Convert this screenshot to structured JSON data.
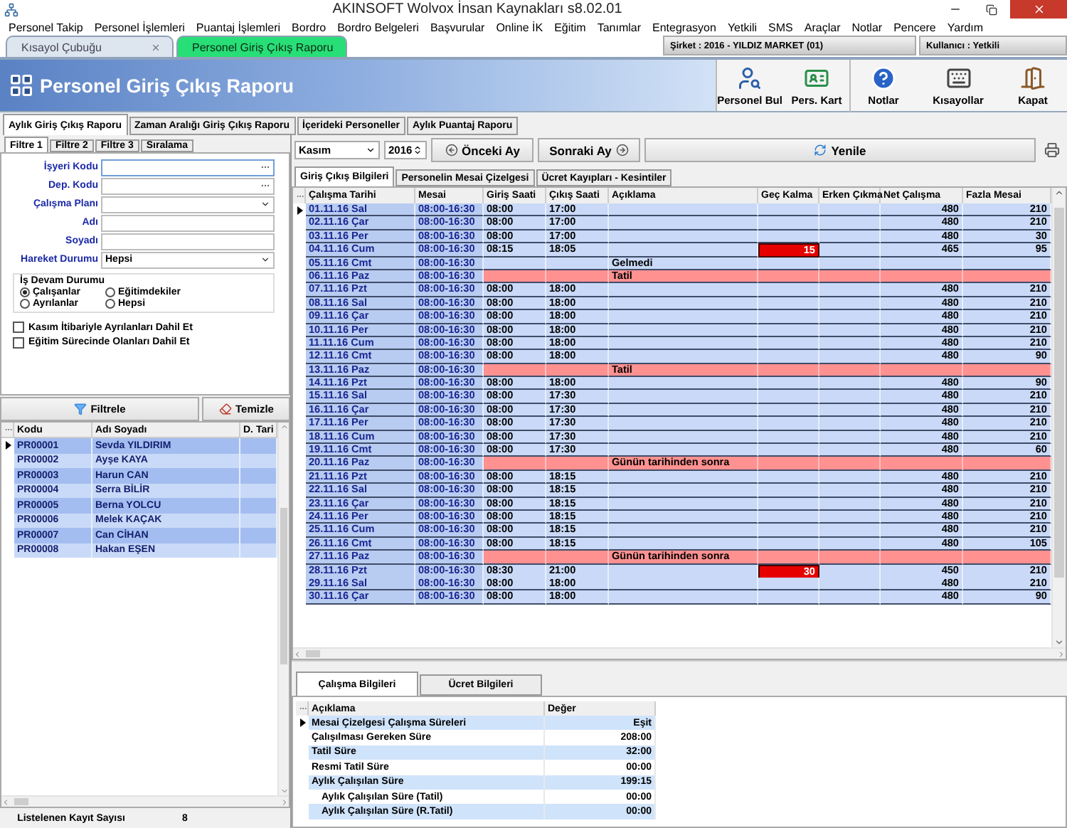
{
  "window": {
    "title": "AKINSOFT Wolvox İnsan Kaynakları s8.02.01"
  },
  "menu": [
    "Personel Takip",
    "Personel İşlemleri",
    "Puantaj İşlemleri",
    "Bordro",
    "Bordro Belgeleri",
    "Başvurular",
    "Online İK",
    "Eğitim",
    "Tanımlar",
    "Entegrasyon",
    "Yetkili",
    "SMS",
    "Araçlar",
    "Notlar",
    "Pencere",
    "Yardım"
  ],
  "doc_tabs": [
    {
      "label": "Kısayol Çubuğu",
      "selected": false
    },
    {
      "label": "Personel Giriş Çıkış Raporu",
      "selected": true
    }
  ],
  "company": "Şirket : 2016 - YILDIZ MARKET (01)",
  "user": "Kullanıcı : Yetkili",
  "header": {
    "title": "Personel Giriş Çıkış Raporu",
    "tools": [
      {
        "label": "Personel Bul",
        "kind": "find"
      },
      {
        "label": "Pers. Kart",
        "kind": "card"
      },
      {
        "label": "Notlar",
        "kind": "notes"
      },
      {
        "label": "Kısayollar",
        "kind": "shortcuts"
      },
      {
        "label": "Kapat",
        "kind": "close"
      }
    ]
  },
  "report_tabs": [
    {
      "label": "Aylık Giriş Çıkış Raporu",
      "selected": true
    },
    {
      "label": "Zaman Aralığı Giriş Çıkış Raporu",
      "selected": false
    },
    {
      "label": "İçerideki Personeller",
      "selected": false
    },
    {
      "label": "Aylık Puantaj Raporu",
      "selected": false
    }
  ],
  "filter": {
    "tabs": [
      {
        "label": "Filtre 1",
        "selected": true
      },
      {
        "label": "Filtre 2",
        "selected": false
      },
      {
        "label": "Filtre 3",
        "selected": false
      },
      {
        "label": "Sıralama",
        "selected": false
      }
    ],
    "fields": [
      {
        "label": "İşyeri Kodu",
        "kind": "lookup"
      },
      {
        "label": "Dep. Kodu",
        "kind": "lookup"
      },
      {
        "label": "Çalışma Planı",
        "kind": "select"
      },
      {
        "label": "Adı",
        "kind": "text"
      },
      {
        "label": "Soyadı",
        "kind": "text"
      },
      {
        "label": "Hareket Durumu",
        "kind": "select",
        "value": "Hepsi"
      }
    ],
    "status_group": {
      "title": "İş Devam Durumu",
      "options": [
        {
          "label": "Çalışanlar",
          "selected": true
        },
        {
          "label": "Eğitimdekiler",
          "selected": false
        },
        {
          "label": "Ayrılanlar",
          "selected": false
        },
        {
          "label": "Hepsi",
          "selected": false
        }
      ]
    },
    "checkboxes": [
      {
        "label": "Kasım İtibariyle Ayrılanları Dahil Et",
        "checked": false
      },
      {
        "label": "Eğitim Sürecinde Olanları Dahil Et",
        "checked": false
      }
    ],
    "buttons": [
      {
        "label": "Filtrele",
        "kind": "filter"
      },
      {
        "label": "Temizle",
        "kind": "clear"
      }
    ]
  },
  "personnel": {
    "columns": [
      "Kodu",
      "Adı Soyadı",
      "D. Tari"
    ],
    "rows": [
      {
        "code": "PR00001",
        "name": "Sevda YILDIRIM",
        "selected": true
      },
      {
        "code": "PR00002",
        "name": "Ayşe KAYA",
        "selected": false
      },
      {
        "code": "PR00003",
        "name": "Harun CAN",
        "selected": false
      },
      {
        "code": "PR00004",
        "name": "Serra BİLİR",
        "selected": false
      },
      {
        "code": "PR00005",
        "name": "Berna YOLCU",
        "selected": false
      },
      {
        "code": "PR00006",
        "name": "Melek KAÇAK",
        "selected": false
      },
      {
        "code": "PR00007",
        "name": "Can CİHAN",
        "selected": false
      },
      {
        "code": "PR00008",
        "name": "Hakan EŞEN",
        "selected": false
      }
    ],
    "footer_label": "Listelenen Kayıt Sayısı",
    "footer_count": "8"
  },
  "period": {
    "month": "Kasım",
    "year": "2016",
    "buttons": [
      {
        "label": "Önceki Ay",
        "kind": "prev"
      },
      {
        "label": "Sonraki Ay",
        "kind": "next"
      },
      {
        "label": "Yenile",
        "kind": "refresh"
      }
    ]
  },
  "detail_tabs": [
    {
      "label": "Giriş Çıkış Bilgileri",
      "selected": true
    },
    {
      "label": "Personelin Mesai Çizelgesi",
      "selected": false
    },
    {
      "label": "Ücret Kayıpları - Kesintiler",
      "selected": false
    }
  ],
  "attendance": {
    "columns": [
      "Çalışma Tarihi",
      "Mesai",
      "Giriş Saati",
      "Çıkış Saati",
      "Açıklama",
      "Geç Kalma",
      "Erken Çıkma",
      "Net Çalışma",
      "Fazla Mesai"
    ],
    "rows": [
      {
        "date": "01.11.16 Sal",
        "mesai": "08:00-16:30",
        "giris": "08:00",
        "cikis": "17:00",
        "net": "480",
        "fazla": "210",
        "kind": "day",
        "selected": true
      },
      {
        "date": "02.11.16 Çar",
        "mesai": "08:00-16:30",
        "giris": "08:00",
        "cikis": "17:00",
        "net": "480",
        "fazla": "210",
        "kind": "day",
        "selected": false
      },
      {
        "date": "03.11.16 Per",
        "mesai": "08:00-16:30",
        "giris": "08:00",
        "cikis": "17:00",
        "net": "480",
        "fazla": "30",
        "kind": "day",
        "selected": false
      },
      {
        "date": "04.11.16 Cum",
        "mesai": "08:00-16:30",
        "giris": "08:15",
        "cikis": "18:05",
        "gec": "15",
        "net": "465",
        "fazla": "95",
        "kind": "day",
        "selected": false
      },
      {
        "date": "05.11.16 Cmt",
        "mesai": "08:00-16:30",
        "aciklama": "Gelmedi",
        "kind": "day",
        "selected": false
      },
      {
        "date": "06.11.16 Paz",
        "mesai": "08:00-16:30",
        "aciklama": "Tatil",
        "kind": "holiday",
        "selected": false
      },
      {
        "date": "07.11.16 Pzt",
        "mesai": "08:00-16:30",
        "giris": "08:00",
        "cikis": "18:00",
        "net": "480",
        "fazla": "210",
        "kind": "day",
        "selected": false
      },
      {
        "date": "08.11.16 Sal",
        "mesai": "08:00-16:30",
        "giris": "08:00",
        "cikis": "18:00",
        "net": "480",
        "fazla": "210",
        "kind": "day",
        "selected": false
      },
      {
        "date": "09.11.16 Çar",
        "mesai": "08:00-16:30",
        "giris": "08:00",
        "cikis": "18:00",
        "net": "480",
        "fazla": "210",
        "kind": "day",
        "selected": false
      },
      {
        "date": "10.11.16 Per",
        "mesai": "08:00-16:30",
        "giris": "08:00",
        "cikis": "18:00",
        "net": "480",
        "fazla": "210",
        "kind": "day",
        "selected": false
      },
      {
        "date": "11.11.16 Cum",
        "mesai": "08:00-16:30",
        "giris": "08:00",
        "cikis": "18:00",
        "net": "480",
        "fazla": "210",
        "kind": "day",
        "selected": false
      },
      {
        "date": "12.11.16 Cmt",
        "mesai": "08:00-16:30",
        "giris": "08:00",
        "cikis": "18:00",
        "net": "480",
        "fazla": "90",
        "kind": "day",
        "selected": false
      },
      {
        "date": "13.11.16 Paz",
        "mesai": "08:00-16:30",
        "aciklama": "Tatil",
        "kind": "holiday",
        "selected": false
      },
      {
        "date": "14.11.16 Pzt",
        "mesai": "08:00-16:30",
        "giris": "08:00",
        "cikis": "18:00",
        "net": "480",
        "fazla": "90",
        "kind": "day",
        "selected": false
      },
      {
        "date": "15.11.16 Sal",
        "mesai": "08:00-16:30",
        "giris": "08:00",
        "cikis": "17:30",
        "net": "480",
        "fazla": "210",
        "kind": "day",
        "selected": false
      },
      {
        "date": "16.11.16 Çar",
        "mesai": "08:00-16:30",
        "giris": "08:00",
        "cikis": "17:30",
        "net": "480",
        "fazla": "210",
        "kind": "day",
        "selected": false
      },
      {
        "date": "17.11.16 Per",
        "mesai": "08:00-16:30",
        "giris": "08:00",
        "cikis": "17:30",
        "net": "480",
        "fazla": "210",
        "kind": "day",
        "selected": false
      },
      {
        "date": "18.11.16 Cum",
        "mesai": "08:00-16:30",
        "giris": "08:00",
        "cikis": "17:30",
        "net": "480",
        "fazla": "210",
        "kind": "day",
        "selected": false
      },
      {
        "date": "19.11.16 Cmt",
        "mesai": "08:00-16:30",
        "giris": "08:00",
        "cikis": "17:30",
        "net": "480",
        "fazla": "60",
        "kind": "day",
        "selected": false
      },
      {
        "date": "20.11.16 Paz",
        "mesai": "08:00-16:30",
        "aciklama": "Günün tarihinden sonra",
        "kind": "holiday",
        "selected": false
      },
      {
        "date": "21.11.16 Pzt",
        "mesai": "08:00-16:30",
        "giris": "08:00",
        "cikis": "18:15",
        "net": "480",
        "fazla": "210",
        "kind": "day",
        "selected": false
      },
      {
        "date": "22.11.16 Sal",
        "mesai": "08:00-16:30",
        "giris": "08:00",
        "cikis": "18:15",
        "net": "480",
        "fazla": "210",
        "kind": "day",
        "selected": false
      },
      {
        "date": "23.11.16 Çar",
        "mesai": "08:00-16:30",
        "giris": "08:00",
        "cikis": "18:15",
        "net": "480",
        "fazla": "210",
        "kind": "day",
        "selected": false
      },
      {
        "date": "24.11.16 Per",
        "mesai": "08:00-16:30",
        "giris": "08:00",
        "cikis": "18:15",
        "net": "480",
        "fazla": "210",
        "kind": "day",
        "selected": false
      },
      {
        "date": "25.11.16 Cum",
        "mesai": "08:00-16:30",
        "giris": "08:00",
        "cikis": "18:15",
        "net": "480",
        "fazla": "210",
        "kind": "day",
        "selected": false
      },
      {
        "date": "26.11.16 Cmt",
        "mesai": "08:00-16:30",
        "giris": "08:00",
        "cikis": "18:15",
        "net": "480",
        "fazla": "105",
        "kind": "day",
        "selected": false
      },
      {
        "date": "27.11.16 Paz",
        "mesai": "08:00-16:30",
        "aciklama": "Günün tarihinden sonra",
        "kind": "holiday",
        "selected": false
      },
      {
        "date": "28.11.16 Pzt",
        "mesai": "08:00-16:30",
        "giris": "08:30",
        "cikis": "21:00",
        "gec": "30",
        "net": "450",
        "fazla": "210",
        "kind": "day",
        "selected": false
      },
      {
        "date": "29.11.16 Sal",
        "mesai": "08:00-16:30",
        "giris": "08:00",
        "cikis": "18:00",
        "net": "480",
        "fazla": "210",
        "kind": "day",
        "selected": false
      },
      {
        "date": "30.11.16 Çar",
        "mesai": "08:00-16:30",
        "giris": "08:00",
        "cikis": "18:00",
        "net": "480",
        "fazla": "90",
        "kind": "day",
        "selected": false
      }
    ]
  },
  "summary": {
    "tabs": [
      {
        "label": "Çalışma Bilgileri",
        "selected": true
      },
      {
        "label": "Ücret Bilgileri",
        "selected": false
      }
    ],
    "columns": [
      "Açıklama",
      "Değer"
    ],
    "rows": [
      {
        "label": "Mesai Çizelgesi Çalışma Süreleri",
        "value": "Eşit",
        "selected": true
      },
      {
        "label": "Çalışılması Gereken Süre",
        "value": "208:00",
        "selected": false
      },
      {
        "label": "Tatil Süre",
        "value": "32:00",
        "selected": false
      },
      {
        "label": "Resmi Tatil Süre",
        "value": "00:00",
        "selected": false
      },
      {
        "label": "Aylık Çalışılan Süre",
        "value": "199:15",
        "selected": false,
        "children": [
          {
            "label": "Aylık Çalışılan Süre (Tatil)",
            "value": "00:00",
            "selected": false
          },
          {
            "label": "Aylık Çalışılan Süre (R.Tatil)",
            "value": "00:00",
            "selected": false
          }
        ]
      }
    ]
  }
}
